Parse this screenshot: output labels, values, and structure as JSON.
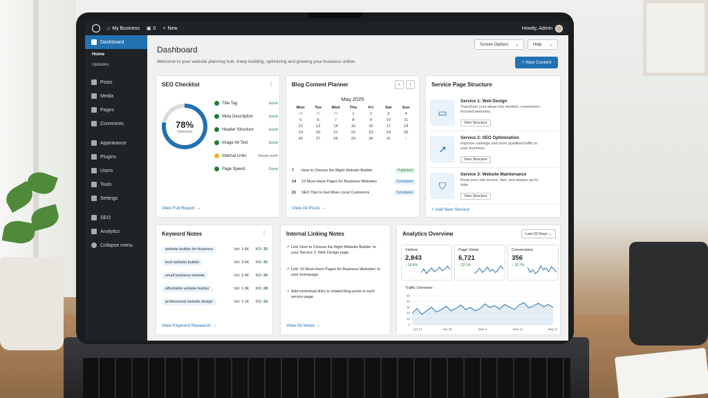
{
  "adminbar": {
    "site": "My Business",
    "comments": "0",
    "new": "New",
    "howdy": "Howdy, Admin"
  },
  "sidebar": {
    "dashboard": "Dashboard",
    "sub": [
      "Home",
      "Updates"
    ],
    "items": [
      "Posts",
      "Media",
      "Pages",
      "Comments",
      "Appearance",
      "Plugins",
      "Users",
      "Tools",
      "Settings",
      "SEO",
      "Analytics",
      "Collapse menu"
    ]
  },
  "header": {
    "title": "Dashboard",
    "welcome": "Welcome to your website planning hub. Keep building, optimizing and growing your business online.",
    "screen_options": "Screen Options",
    "help": "Help",
    "new_content": "+ New Content"
  },
  "seo": {
    "title": "SEO Checklist",
    "percent": "78%",
    "label": "Optimized",
    "link": "View Full Report →",
    "items": [
      {
        "name": "Title Tag",
        "status": "Good"
      },
      {
        "name": "Meta Description",
        "status": "Good"
      },
      {
        "name": "Header Structure",
        "status": "Good"
      },
      {
        "name": "Image Alt Text",
        "status": "Good"
      },
      {
        "name": "Internal Links",
        "status": "Needs work"
      },
      {
        "name": "Page Speed",
        "status": "Good"
      }
    ],
    "colors": {
      "good": "#1e7e34",
      "warn": "#f0b429"
    }
  },
  "planner": {
    "title": "Blog Content Planner",
    "month": "May 2025",
    "prev": "‹",
    "next": "›",
    "days": [
      "Mon",
      "Tue",
      "Wed",
      "Thu",
      "Fri",
      "Sat",
      "Sun"
    ],
    "weeks": [
      [
        "28",
        "29",
        "30",
        "1",
        "2",
        "3",
        "4"
      ],
      [
        "5",
        "6",
        "7",
        "8",
        "9",
        "10",
        "11"
      ],
      [
        "12",
        "13",
        "14",
        "15",
        "16",
        "17",
        "18"
      ],
      [
        "19",
        "20",
        "21",
        "22",
        "23",
        "24",
        "25"
      ],
      [
        "26",
        "27",
        "28",
        "29",
        "30",
        "31",
        "1"
      ]
    ],
    "posts": [
      {
        "day": "7",
        "title": "How to Choose the Right Website Builder",
        "status": "Published"
      },
      {
        "day": "14",
        "title": "10 Must-Have Pages for Business Websites",
        "status": "Scheduled"
      },
      {
        "day": "21",
        "title": "SEO Tips to Get More Local Customers",
        "status": "Scheduled"
      }
    ],
    "link": "View All Posts →"
  },
  "services": {
    "title": "Service Page Structure",
    "items": [
      {
        "title": "Service 1: Web Design",
        "desc": "Transform your ideas into modern, conversion-focused websites.",
        "button": "View Structure",
        "icon": "monitor-icon"
      },
      {
        "title": "Service 2: SEO Optimization",
        "desc": "Improve rankings and drive qualified traffic to your business.",
        "button": "View Structure",
        "icon": "chart-up-icon"
      },
      {
        "title": "Service 3: Website Maintenance",
        "desc": "Keep your site secure, fast, and always up-to-date.",
        "button": "View Structure",
        "icon": "shield-icon"
      }
    ],
    "add": "+ Add New Service"
  },
  "keywords": {
    "title": "Keyword Notes",
    "link": "View Keyword Research →",
    "rows": [
      {
        "kw": "website builder for business",
        "vol": "Vol: 1.6K",
        "kd_label": "KD: ",
        "kd": "35"
      },
      {
        "kw": "best website builder",
        "vol": "Vol: 3.6K",
        "kd_label": "KD: ",
        "kd": "42"
      },
      {
        "kw": "small business website",
        "vol": "Vol: 2.4K",
        "kd_label": "KD: ",
        "kd": "30"
      },
      {
        "kw": "affordable website builder",
        "vol": "Vol: 1.3K",
        "kd_label": "KD: ",
        "kd": "28"
      },
      {
        "kw": "professional website design",
        "vol": "Vol: 1.1K",
        "kd_label": "KD: ",
        "kd": "33"
      }
    ]
  },
  "linking": {
    "title": "Internal Linking Notes",
    "link": "View All Notes →",
    "rows": [
      "Link 'How to Choose the Right Website Builder' to your Service 1: Web Design page.",
      "Link '10 Must-Have Pages for Business Websites' to your homepage.",
      "Add contextual links to related blog posts in each service page."
    ]
  },
  "analytics": {
    "title": "Analytics Overview",
    "range": "Last 30 Days",
    "stats": [
      {
        "label": "Visitors",
        "value": "2,843",
        "change": "↑ 18.4%"
      },
      {
        "label": "Page Views",
        "value": "6,721",
        "change": "↑ 22.1%"
      },
      {
        "label": "Conversions",
        "value": "356",
        "change": "↑ 15.7%"
      }
    ],
    "traffic_title": "Traffic Overview"
  },
  "chart_data": {
    "type": "line",
    "title": "Traffic Overview",
    "x": [
      "Apr 21",
      "Apr 28",
      "May 5",
      "May 12",
      "May 19"
    ],
    "ylim": [
      0,
      50
    ],
    "yticks": [
      "0",
      "10",
      "20",
      "30",
      "40",
      "50"
    ],
    "values": [
      20,
      28,
      18,
      24,
      30,
      22,
      26,
      32,
      24,
      28,
      34,
      26,
      30,
      24,
      28,
      36,
      30,
      33,
      27,
      35,
      31,
      26,
      34,
      38,
      29,
      33,
      37,
      31,
      35,
      30
    ]
  }
}
